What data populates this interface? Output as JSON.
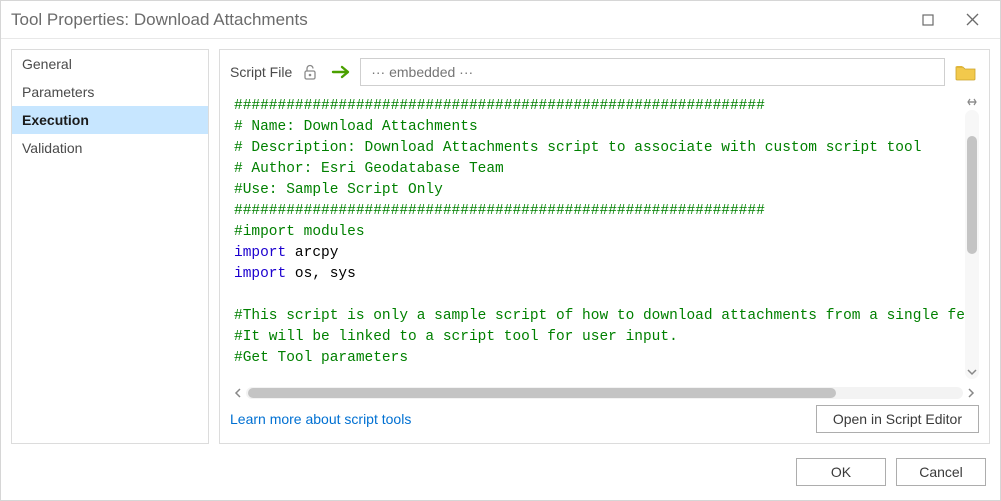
{
  "window": {
    "title": "Tool Properties: Download Attachments"
  },
  "sidebar": {
    "items": [
      {
        "label": "General",
        "selected": false
      },
      {
        "label": "Parameters",
        "selected": false
      },
      {
        "label": "Execution",
        "selected": true
      },
      {
        "label": "Validation",
        "selected": false
      }
    ]
  },
  "toolbar": {
    "label": "Script File",
    "path_placeholder": "··· embedded ···"
  },
  "code": {
    "lines": [
      {
        "cls": "comment",
        "text": "#############################################################"
      },
      {
        "cls": "comment",
        "text": "# Name: Download Attachments"
      },
      {
        "cls": "comment",
        "text": "# Description: Download Attachments script to associate with custom script tool"
      },
      {
        "cls": "comment",
        "text": "# Author: Esri Geodatabase Team"
      },
      {
        "cls": "comment",
        "text": "#Use: Sample Script Only"
      },
      {
        "cls": "comment",
        "text": "#############################################################"
      },
      {
        "cls": "comment",
        "text": "#import modules"
      },
      {
        "cls": "import",
        "kw": "import",
        "rest": " arcpy"
      },
      {
        "cls": "import",
        "kw": "import",
        "rest": " os, sys"
      },
      {
        "cls": "blank",
        "text": ""
      },
      {
        "cls": "comment",
        "text": "#This script is only a sample script of how to download attachments from a single feature"
      },
      {
        "cls": "comment",
        "text": "#It will be linked to a script tool for user input."
      },
      {
        "cls": "comment",
        "text": "#Get Tool parameters"
      }
    ]
  },
  "links": {
    "learn_more": "Learn more about script tools"
  },
  "buttons": {
    "open_editor": "Open in Script Editor",
    "ok": "OK",
    "cancel": "Cancel"
  }
}
